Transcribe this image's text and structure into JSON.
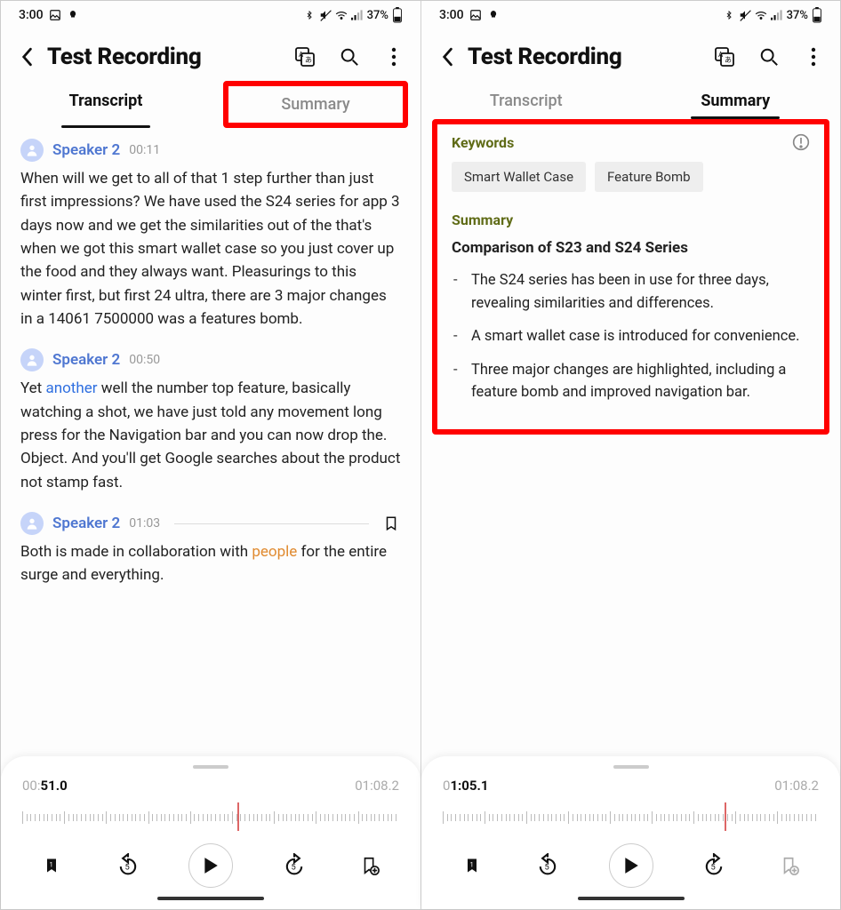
{
  "status": {
    "time": "3:00",
    "battery": "37%"
  },
  "header": {
    "title": "Test Recording"
  },
  "tabs": {
    "transcript": "Transcript",
    "summary": "Summary"
  },
  "left": {
    "blocks": [
      {
        "speaker": "Speaker 2",
        "time": "00:11",
        "text_pre": "When will we get to all of that 1 step further than just first impressions? We have used the S24 series for app 3 days now and we get the similarities out of the that's when we got this smart wallet case so you just cover up the food and they always want. Pleasurings to this winter first, but first 24 ultra, there are 3 major changes in a 14061 7500000 was a features bomb."
      },
      {
        "speaker": "Speaker 2",
        "time": "00:50",
        "text_pre": "Yet ",
        "link": "another",
        "text_post": " well the number top feature, basically watching a shot, we have just told any movement long press for the Navigation bar and you can now drop the. Object. And you'll get Google searches about the product not stamp fast."
      },
      {
        "speaker": "Speaker 2",
        "time": "01:03",
        "bookmark": true,
        "text_pre": "Both is made in collaboration with ",
        "link2": "people",
        "text_post2": " for the entire surge and everything."
      }
    ],
    "player": {
      "current_pre": "00:",
      "current_bold": "51.0",
      "total": "01:08.2",
      "playhead_pct": 57
    }
  },
  "right": {
    "keywords_label": "Keywords",
    "keywords": [
      "Smart Wallet Case",
      "Feature Bomb"
    ],
    "summary_label": "Summary",
    "summary_title": "Comparison of S23 and S24 Series",
    "bullets": [
      "The S24 series has been in use for three days, revealing similarities and differences.",
      "A smart wallet case is introduced for convenience.",
      "Three major changes are highlighted, including a feature bomb and improved navigation bar."
    ],
    "player": {
      "current_pre": "0",
      "current_bold": "1:05.1",
      "total": "01:08.2",
      "playhead_pct": 75
    }
  }
}
